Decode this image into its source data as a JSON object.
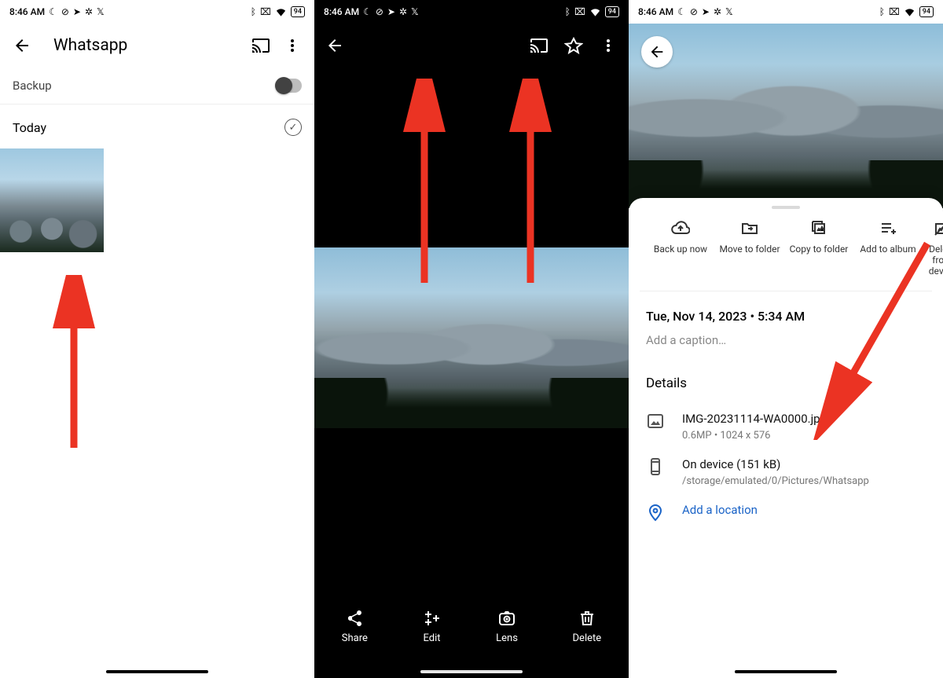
{
  "status": {
    "time": "8:46 AM",
    "battery": "94"
  },
  "panel1": {
    "title": "Whatsapp",
    "backup_label": "Backup",
    "today_label": "Today"
  },
  "panel2": {
    "actions": {
      "share": "Share",
      "edit": "Edit",
      "lens": "Lens",
      "delete": "Delete"
    }
  },
  "panel3": {
    "actions": {
      "backup": "Back up now",
      "move": "Move to folder",
      "copy": "Copy to folder",
      "album": "Add to album",
      "delete": "Delete from device"
    },
    "date_line": "Tue, Nov 14, 2023  •  5:34 AM",
    "caption_placeholder": "Add a caption…",
    "details_title": "Details",
    "file": {
      "name": "IMG-20231114-WA0000.jpg",
      "meta": "0.6MP  •  1024 x 576"
    },
    "storage": {
      "line1": "On device (151 kB)",
      "line2": "/storage/emulated/0/Pictures/Whatsapp"
    },
    "add_location": "Add a location"
  }
}
